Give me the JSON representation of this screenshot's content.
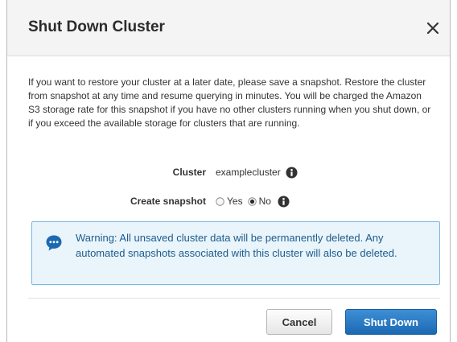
{
  "dialog": {
    "title": "Shut Down Cluster",
    "close_label": "×",
    "description": "If you want to restore your cluster at a later date, please save a snapshot. Restore the cluster from snapshot at any time and resume querying in minutes. You will be charged the Amazon S3 storage rate for this snapshot if you have no other clusters running when you shut down, or if you exceed the available storage for clusters that are running.",
    "cluster": {
      "label": "Cluster",
      "value": "examplecluster",
      "icon": "info-icon"
    },
    "snapshot": {
      "label": "Create snapshot",
      "options": [
        {
          "label": "Yes",
          "selected": false
        },
        {
          "label": "No",
          "selected": true
        }
      ],
      "icon": "info-icon"
    },
    "warning": {
      "icon": "chat-bubble-icon",
      "text": "Warning: All unsaved cluster data will be permanently deleted. Any automated snapshots associated with this cluster will also be deleted."
    },
    "buttons": {
      "cancel": "Cancel",
      "shut_down": "Shut Down"
    }
  },
  "colors": {
    "primary_button": "#1c69b3",
    "warning_bg": "#eaf4fb",
    "warning_border": "#7ab8e0",
    "warning_text": "#1c5c8c"
  }
}
